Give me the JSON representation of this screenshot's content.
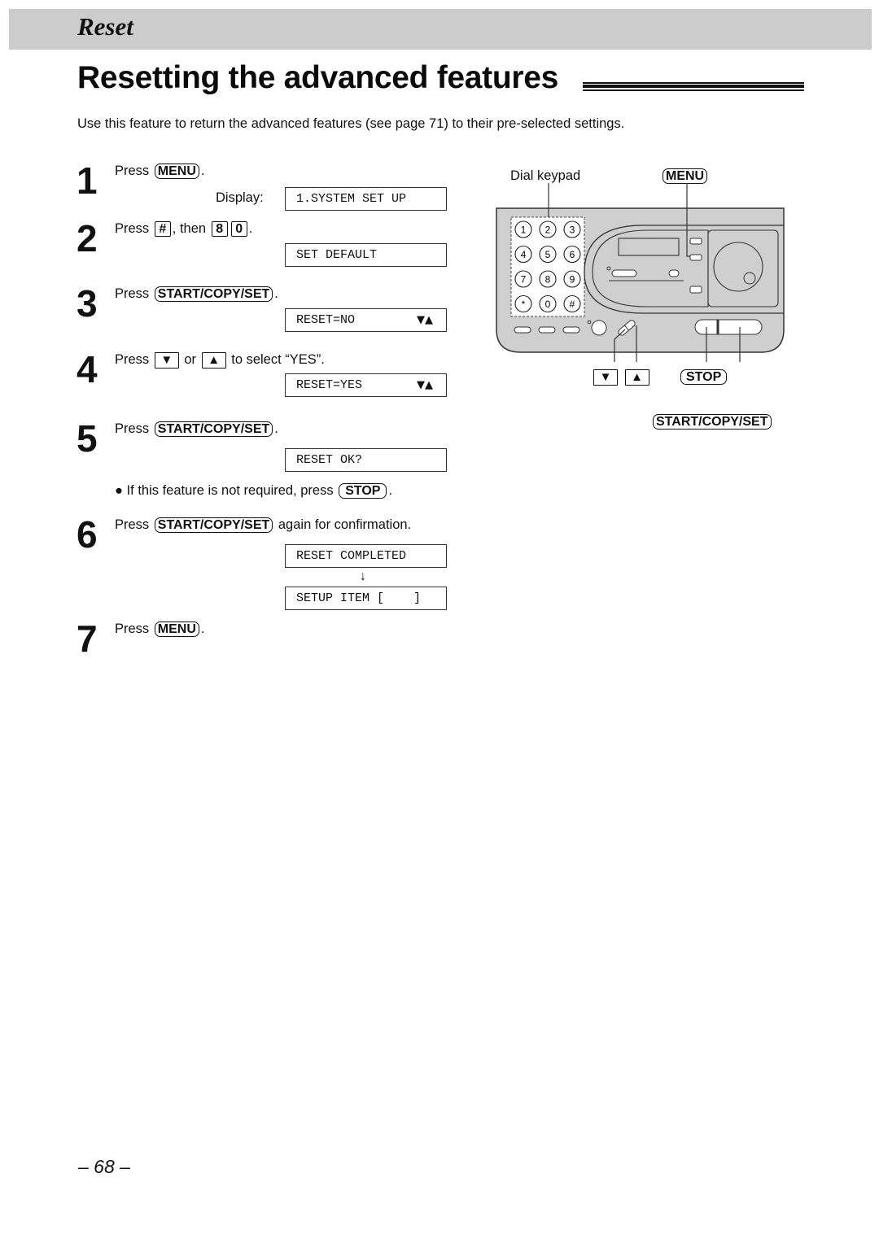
{
  "header": {
    "section": "Reset"
  },
  "page_title": "Resetting the advanced features",
  "intro": "Use this feature to return the advanced features (see page 71) to their pre-selected settings.",
  "steps": [
    {
      "num": "1",
      "pre": "Press",
      "key": "MENU",
      "post": ".",
      "display_label": "Display:",
      "displays": [
        "1.SYSTEM SET UP"
      ]
    },
    {
      "num": "2",
      "pre": "Press",
      "key": "#",
      "mid": ", then",
      "keys": [
        "8",
        "0"
      ],
      "post": ".",
      "displays": [
        "SET DEFAULT"
      ]
    },
    {
      "num": "3",
      "pre": "Press",
      "key": "START/COPY/SET",
      "post": ".",
      "displays": [
        "RESET=NO"
      ]
    },
    {
      "num": "4",
      "pre": "Press",
      "key_down": "▼",
      "mid": "or",
      "key_up": "▲",
      "post": "to select “YES”.",
      "displays": [
        "RESET=YES"
      ]
    },
    {
      "num": "5",
      "pre": "Press",
      "key": "START/COPY/SET",
      "post": ".",
      "displays": [
        "RESET OK?"
      ],
      "note": "If this feature is not required, press",
      "note_key": "STOP",
      "note_post": "."
    },
    {
      "num": "6",
      "pre": "Press",
      "key": "START/COPY/SET",
      "post": "again for confirmation.",
      "displays": [
        "RESET COMPLETED",
        "SETUP ITEM [    ]"
      ]
    },
    {
      "num": "7",
      "pre": "Press",
      "key": "MENU",
      "post": "."
    }
  ],
  "display_arrows": "▼▲",
  "flow_arrow": "↓",
  "diagram": {
    "labels": {
      "dial_keypad": "Dial keypad",
      "menu": "MENU",
      "down": "▼",
      "up": "▲",
      "stop": "STOP",
      "start_copy_set": "START/COPY/SET"
    },
    "keypad": [
      "1",
      "2",
      "3",
      "4",
      "5",
      "6",
      "7",
      "8",
      "9",
      "*",
      "0",
      "#"
    ]
  },
  "page_number": "– 68 –"
}
